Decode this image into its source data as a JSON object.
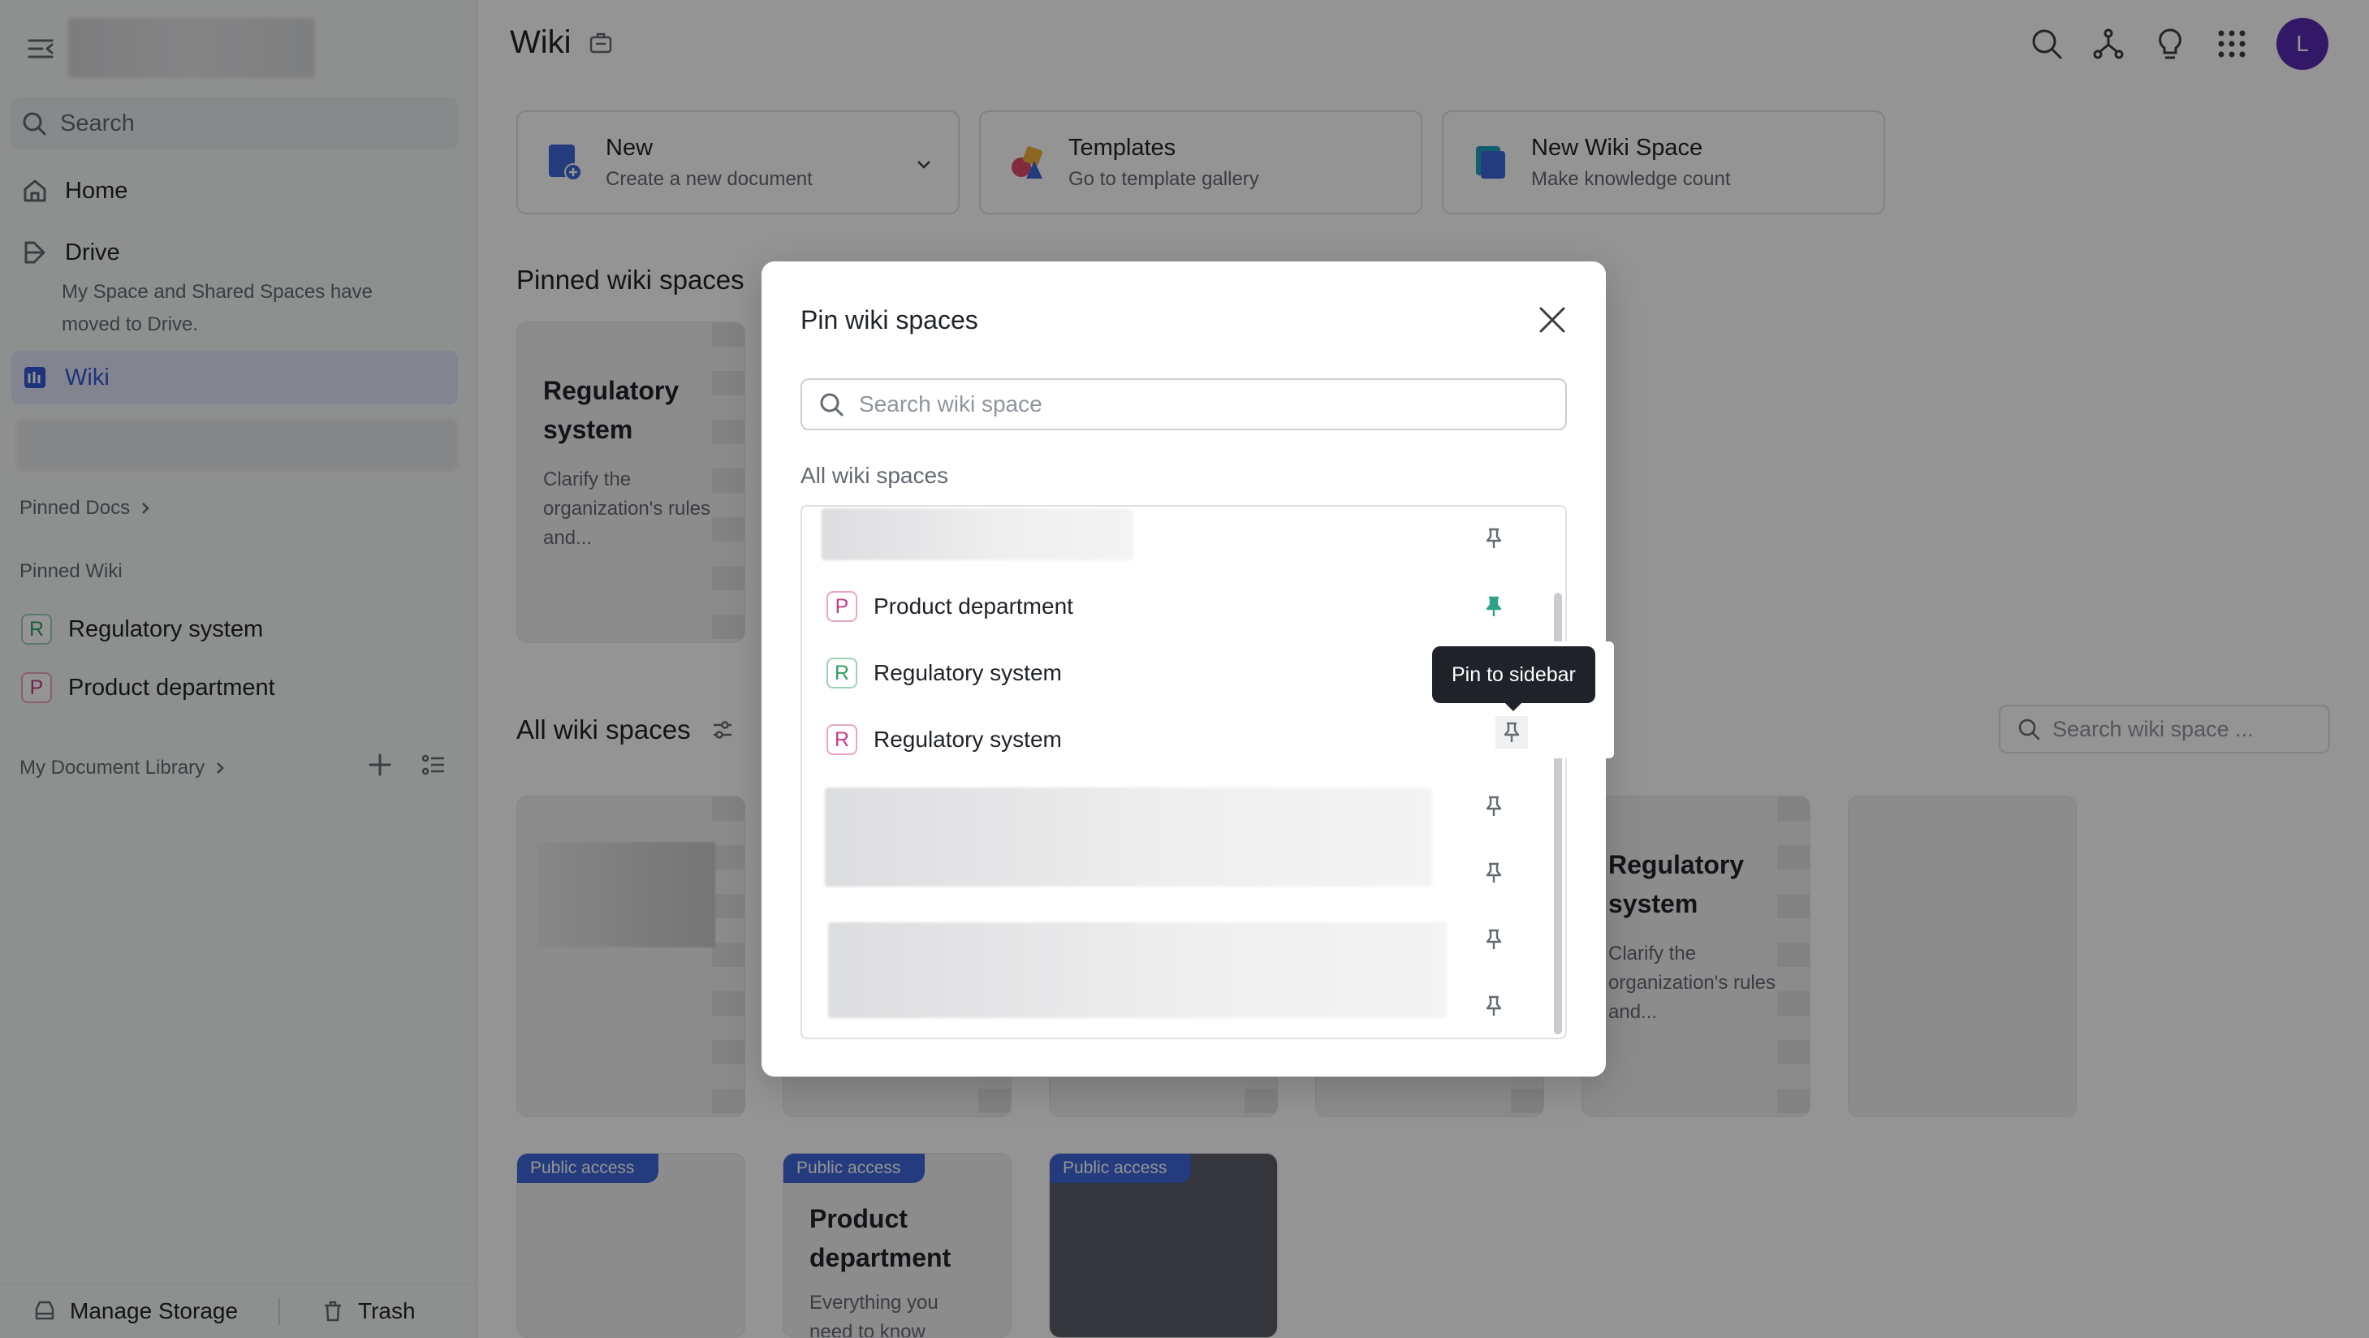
{
  "sidebar": {
    "search_label": "Search",
    "nav": [
      {
        "label": "Home"
      },
      {
        "label": "Drive"
      },
      {
        "label": "Wiki"
      }
    ],
    "drive_note": "My Space and Shared Spaces have moved to Drive.",
    "pinned_docs_label": "Pinned Docs",
    "pinned_wiki_label": "Pinned Wiki",
    "pinned_wiki": [
      {
        "letter": "R",
        "label": "Regulatory system"
      },
      {
        "letter": "P",
        "label": "Product department"
      }
    ],
    "doc_library_label": "My Document Library",
    "manage_storage_label": "Manage Storage",
    "trash_label": "Trash"
  },
  "header": {
    "title": "Wiki",
    "avatar_letter": "L"
  },
  "actions": [
    {
      "title": "New",
      "subtitle": "Create a new document"
    },
    {
      "title": "Templates",
      "subtitle": "Go to template gallery"
    },
    {
      "title": "New Wiki Space",
      "subtitle": "Make knowledge count"
    }
  ],
  "main": {
    "pinned_title": "Pinned wiki spaces",
    "pinned_card": {
      "title": "Regulatory system",
      "desc": "Clarify the organization's rules and..."
    },
    "all_title": "All wiki spaces",
    "search_placeholder": "Search wiki space ...",
    "grid_card": {
      "title": "Regulatory system",
      "desc": "Clarify the organization's rules and..."
    },
    "public_badge": "Public access",
    "public_card": {
      "title": "Product department",
      "desc": "Everything you need to know"
    }
  },
  "modal": {
    "title": "Pin wiki spaces",
    "search_placeholder": "Search wiki space",
    "subtitle": "All wiki spaces",
    "rows": [
      {
        "letter": "P",
        "label": "Product department",
        "pinned": true
      },
      {
        "letter": "R",
        "label": "Regulatory system",
        "pinned": false
      },
      {
        "letter": "R",
        "label": "Regulatory system",
        "pinned": false
      }
    ],
    "tooltip": "Pin to sidebar"
  },
  "colors": {
    "accent": "#3358d4",
    "pinned_icon": "#2ea189",
    "badge": "#3f67d8",
    "avatar": "#5b2ab3"
  }
}
